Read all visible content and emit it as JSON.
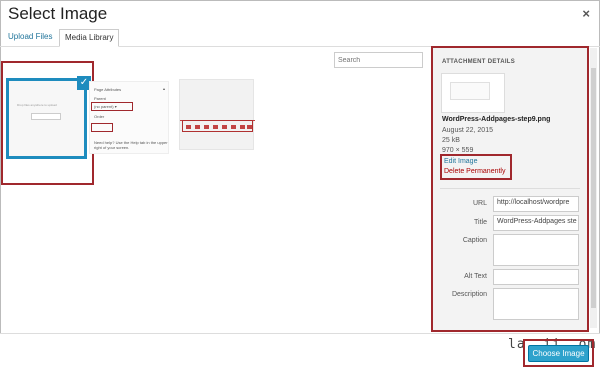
{
  "header": {
    "title": "Select Image",
    "close_icon": "×"
  },
  "tabs": [
    {
      "label": "Upload Files"
    },
    {
      "label": "Media Library"
    }
  ],
  "search": {
    "placeholder": "Search"
  },
  "thumb1": {
    "caption": "Drop files anywhere to upload"
  },
  "thumb2": {
    "header": "Page Attributes",
    "label_parent": "Parent",
    "select_value": "(no parent)",
    "label_order": "Order",
    "help_text": "Need help? Use the Help tab in the upper right of your screen."
  },
  "sidebar": {
    "title": "ATTACHMENT DETAILS",
    "filename": "WordPress-Addpages-step9.png",
    "date": "August 22, 2015",
    "size": "25 kB",
    "dimensions": "970 × 559",
    "edit_link": "Edit Image",
    "delete_link": "Delete Permanently",
    "fields": [
      {
        "label": "URL",
        "value": "http://localhost/wordpre"
      },
      {
        "label": "Title",
        "value": "WordPress-Addpages ste"
      },
      {
        "label": "Caption",
        "value": ""
      },
      {
        "label": "Alt Text",
        "value": ""
      },
      {
        "label": "Description",
        "value": ""
      }
    ]
  },
  "footer": {
    "choose_button": "Choose Image",
    "watermark": "la..ii..om"
  },
  "colors": {
    "accent": "#2ea2cc",
    "highlight": "#a0282d",
    "link": "#21759b"
  }
}
